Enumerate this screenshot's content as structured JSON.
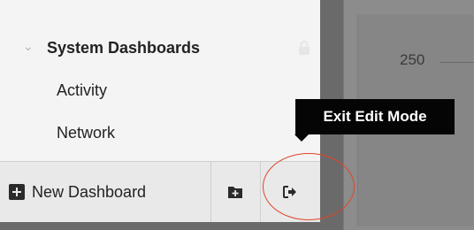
{
  "background": {
    "axis_tick": "250"
  },
  "sidebar": {
    "group": {
      "label": "System Dashboards",
      "chevron_icon": "chevron-down-icon",
      "lock_icon": "lock-icon"
    },
    "items": [
      {
        "label": "Activity"
      },
      {
        "label": "Network"
      }
    ]
  },
  "toolbar": {
    "new_dashboard": {
      "label": "New Dashboard",
      "icon": "plus-square-icon"
    },
    "add_folder": {
      "icon": "folder-plus-icon"
    },
    "exit_edit": {
      "icon": "sign-out-icon"
    }
  },
  "tooltip": {
    "text": "Exit Edit Mode"
  },
  "colors": {
    "highlight": "#e0452a",
    "tooltip_bg": "#050505",
    "panel_bg": "#f4f4f4"
  }
}
